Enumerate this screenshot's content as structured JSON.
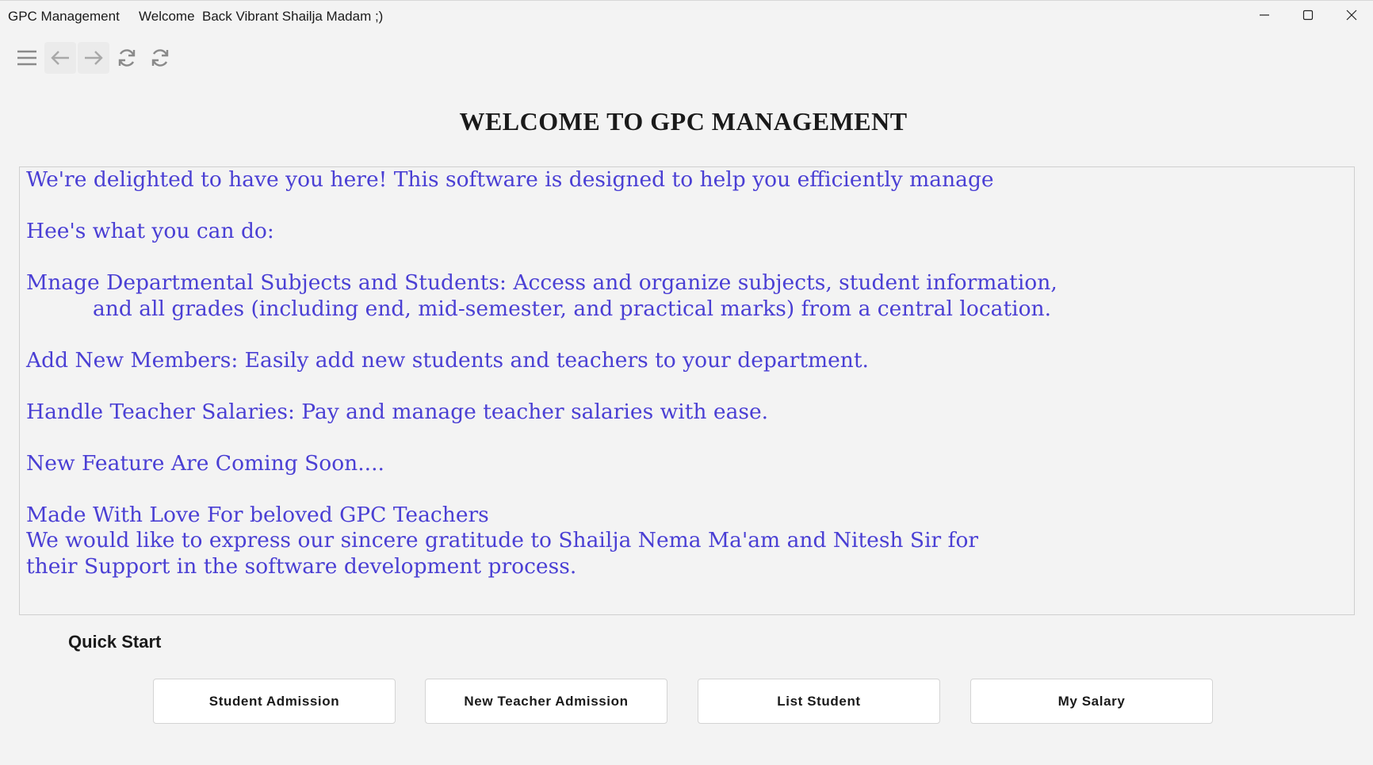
{
  "titlebar": {
    "app_name": "GPC Management",
    "welcome": "Welcome  Back Vibrant Shailja Madam ;)",
    "controls": {
      "minimize": "minimize-icon",
      "maximize": "maximize-icon",
      "close": "close-icon"
    }
  },
  "toolbar": {
    "icons": [
      "menu-icon",
      "back-arrow-icon",
      "forward-arrow-icon",
      "refresh-icon",
      "reload-icon"
    ]
  },
  "main": {
    "heading": "WELCOME TO GPC MANAGEMENT",
    "welcome_lines": [
      "We're delighted to have you here! This software is designed to help you efficiently manage",
      "Hee's what you can do:",
      "Mnage Departmental Subjects and Students: Access and organize subjects, student information,",
      "and all grades (including end, mid-semester, and practical marks) from a central location.",
      "Add New Members: Easily add new students and teachers to your department.",
      "Handle Teacher Salaries: Pay and manage teacher salaries with ease.",
      "New Feature Are Coming Soon....",
      "Made With Love For beloved GPC Teachers",
      "We would like to express our sincere gratitude to Shailja Nema Ma'am and Nitesh Sir for",
      "their Support in the software development process."
    ],
    "text_color": "#4a3fd4"
  },
  "quick_start": {
    "label": "Quick Start",
    "buttons": [
      "Student Admission",
      "New Teacher Admission",
      "List Student",
      "My Salary"
    ]
  }
}
